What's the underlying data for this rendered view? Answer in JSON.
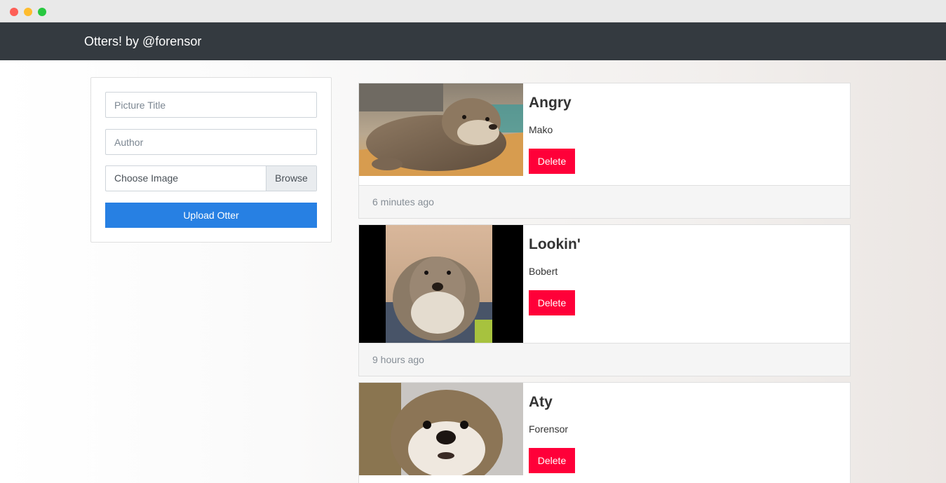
{
  "navbar": {
    "brand": "Otters! by @forensor"
  },
  "form": {
    "title_placeholder": "Picture Title",
    "author_placeholder": "Author",
    "file_label": "Choose Image",
    "browse_label": "Browse",
    "upload_label": "Upload Otter"
  },
  "posts": [
    {
      "title": "Angry",
      "author": "Mako",
      "delete_label": "Delete",
      "time": "6 minutes ago"
    },
    {
      "title": "Lookin'",
      "author": "Bobert",
      "delete_label": "Delete",
      "time": "9 hours ago"
    },
    {
      "title": "Aty",
      "author": "Forensor",
      "delete_label": "Delete"
    }
  ],
  "colors": {
    "navbar": "#343a40",
    "primary": "#2780e3",
    "danger": "#ff0039"
  }
}
